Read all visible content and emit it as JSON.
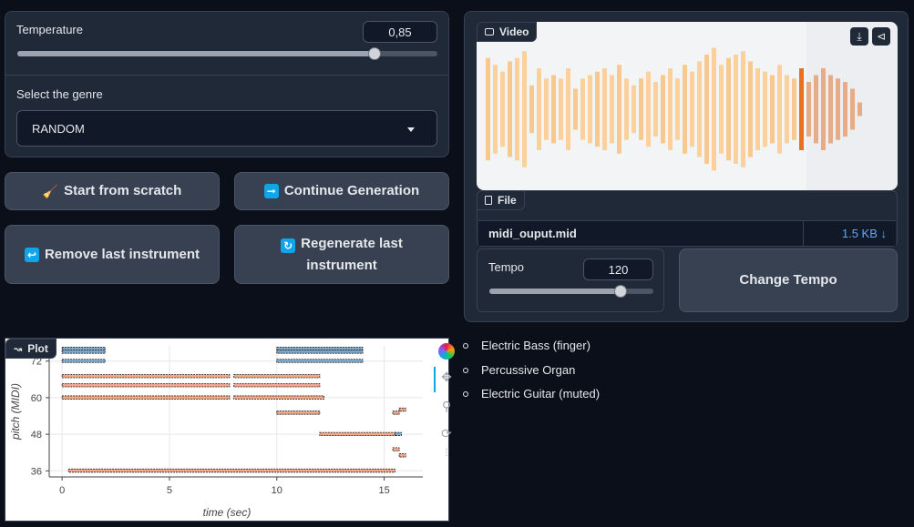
{
  "temperature": {
    "label": "Temperature",
    "value": "0,85",
    "level": 0.85
  },
  "genre": {
    "label": "Select the genre",
    "selected": "RANDOM"
  },
  "buttons": {
    "start": {
      "icon": "broom-icon",
      "label": "Start from scratch"
    },
    "continue": {
      "icon": "arrow-right-icon",
      "label": "Continue Generation"
    },
    "remove": {
      "icon": "return-arrow-icon",
      "label": "Remove last instrument"
    },
    "regenerate": {
      "icon": "refresh-icon",
      "label": "Regenerate last instrument"
    }
  },
  "video": {
    "label": "Video",
    "download_icon": "download-icon",
    "share_icon": "share-icon"
  },
  "file": {
    "label": "File",
    "name": "midi_ouput.mid",
    "size": "1.5 KB ↓"
  },
  "tempo": {
    "label": "Tempo",
    "value": "120",
    "level": 0.8,
    "button": "Change Tempo"
  },
  "plot": {
    "label": "Plot"
  },
  "legend": [
    "Electric Bass (finger)",
    "Percussive Organ",
    "Electric Guitar (muted)"
  ],
  "chart_data": {
    "type": "scatter",
    "title": "",
    "xlabel": "time (sec)",
    "ylabel": "pitch (MIDI)",
    "xlim": [
      -0.6,
      16.8
    ],
    "ylim": [
      34,
      77
    ],
    "x_ticks": [
      "0",
      "5",
      "10",
      "15"
    ],
    "x_tick_values": [
      0,
      5,
      10,
      15
    ],
    "y_ticks": [
      "36",
      "48",
      "60",
      "72"
    ],
    "y_tick_values": [
      36,
      48,
      60,
      72
    ],
    "grid": true,
    "colors": {
      "Electric Bass (finger)": "#f2a98a",
      "Percussive Organ": "#7fa8c9",
      "Electric Guitar (muted)": "#d9a27f"
    },
    "series": [
      {
        "name": "Percussive Organ",
        "notes": [
          {
            "start": 0,
            "end": 2,
            "pitch": 76
          },
          {
            "start": 0,
            "end": 2,
            "pitch": 75
          },
          {
            "start": 0,
            "end": 2,
            "pitch": 72
          },
          {
            "start": 10,
            "end": 14,
            "pitch": 76
          },
          {
            "start": 10,
            "end": 14,
            "pitch": 75
          },
          {
            "start": 10,
            "end": 14,
            "pitch": 72
          },
          {
            "start": 15.5,
            "end": 15.8,
            "pitch": 48
          }
        ]
      },
      {
        "name": "Electric Bass (finger)",
        "notes": [
          {
            "start": 0,
            "end": 7.8,
            "pitch": 67
          },
          {
            "start": 0,
            "end": 7.8,
            "pitch": 64
          },
          {
            "start": 0,
            "end": 7.8,
            "pitch": 60
          },
          {
            "start": 8,
            "end": 12,
            "pitch": 67
          },
          {
            "start": 8,
            "end": 12,
            "pitch": 64
          },
          {
            "start": 8,
            "end": 12.2,
            "pitch": 60
          },
          {
            "start": 10,
            "end": 12,
            "pitch": 55
          },
          {
            "start": 12,
            "end": 15.5,
            "pitch": 48
          },
          {
            "start": 15.4,
            "end": 15.7,
            "pitch": 55
          },
          {
            "start": 15.7,
            "end": 16,
            "pitch": 56
          },
          {
            "start": 15.4,
            "end": 15.7,
            "pitch": 43
          },
          {
            "start": 15.7,
            "end": 16,
            "pitch": 41
          },
          {
            "start": 0.3,
            "end": 15.5,
            "pitch": 36
          }
        ]
      }
    ]
  }
}
